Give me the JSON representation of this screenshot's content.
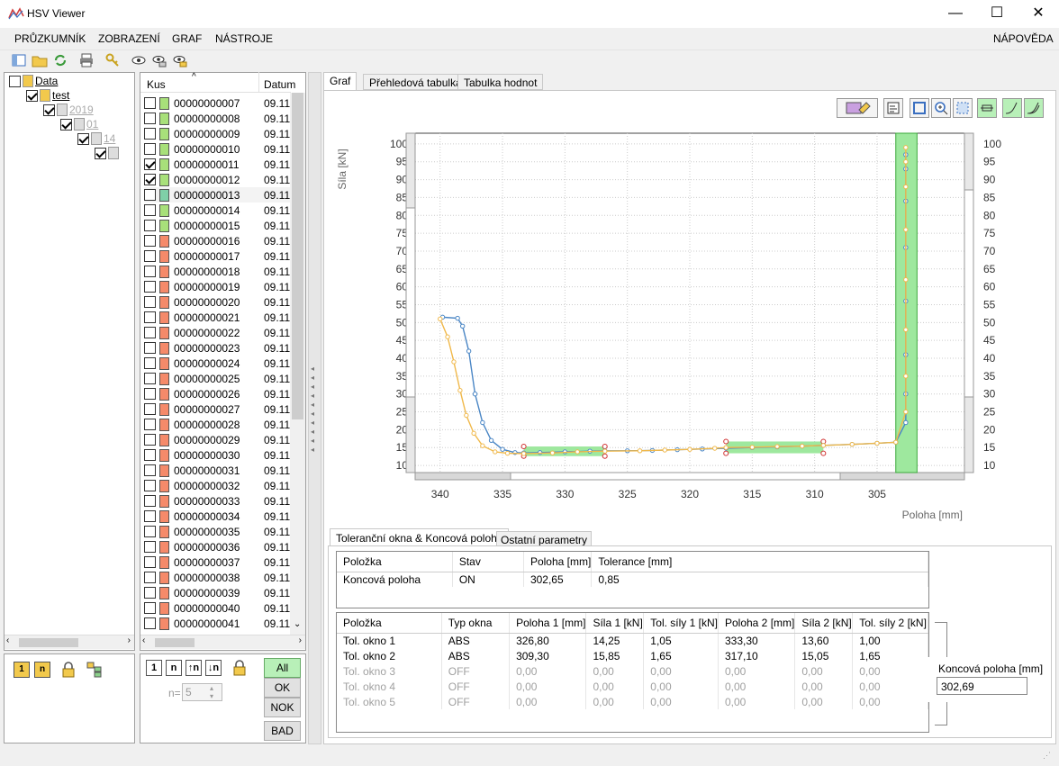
{
  "window": {
    "title": "HSV Viewer",
    "minimize": "—",
    "maximize": "☐",
    "close": "✕"
  },
  "menu": {
    "items": [
      "PRŮZKUMNÍK",
      "ZOBRAZENÍ",
      "GRAF",
      "NÁSTROJE"
    ],
    "help": "NÁPOVĚDA"
  },
  "tree": [
    {
      "label": "Data",
      "level": 0,
      "checked": false,
      "gray": false
    },
    {
      "label": "test",
      "level": 1,
      "checked": true,
      "gray": false
    },
    {
      "label": "2019",
      "level": 2,
      "checked": true,
      "gray": true
    },
    {
      "label": "01",
      "level": 3,
      "checked": true,
      "gray": true
    },
    {
      "label": "14",
      "level": 4,
      "checked": true,
      "gray": true
    },
    {
      "label": "",
      "level": 5,
      "checked": true,
      "gray": true
    }
  ],
  "list": {
    "col_kus": "Kus",
    "col_datum": "Datum",
    "items": [
      {
        "id": "00000000007",
        "date": "09.11",
        "ok": true,
        "checked": false
      },
      {
        "id": "00000000008",
        "date": "09.11",
        "ok": true,
        "checked": false
      },
      {
        "id": "00000000009",
        "date": "09.11",
        "ok": true,
        "checked": false
      },
      {
        "id": "00000000010",
        "date": "09.11",
        "ok": true,
        "checked": false
      },
      {
        "id": "00000000011",
        "date": "09.11",
        "ok": true,
        "checked": true
      },
      {
        "id": "00000000012",
        "date": "09.11",
        "ok": true,
        "checked": true
      },
      {
        "id": "00000000013",
        "date": "09.11",
        "ok": true,
        "checked": false,
        "selected": true
      },
      {
        "id": "00000000014",
        "date": "09.11",
        "ok": true,
        "checked": false
      },
      {
        "id": "00000000015",
        "date": "09.11",
        "ok": true,
        "checked": false
      },
      {
        "id": "00000000016",
        "date": "09.11",
        "ok": false,
        "checked": false
      },
      {
        "id": "00000000017",
        "date": "09.11",
        "ok": false,
        "checked": false
      },
      {
        "id": "00000000018",
        "date": "09.11",
        "ok": false,
        "checked": false
      },
      {
        "id": "00000000019",
        "date": "09.11",
        "ok": false,
        "checked": false
      },
      {
        "id": "00000000020",
        "date": "09.11",
        "ok": false,
        "checked": false
      },
      {
        "id": "00000000021",
        "date": "09.11",
        "ok": false,
        "checked": false
      },
      {
        "id": "00000000022",
        "date": "09.11",
        "ok": false,
        "checked": false
      },
      {
        "id": "00000000023",
        "date": "09.11",
        "ok": false,
        "checked": false
      },
      {
        "id": "00000000024",
        "date": "09.11",
        "ok": false,
        "checked": false
      },
      {
        "id": "00000000025",
        "date": "09.11",
        "ok": false,
        "checked": false
      },
      {
        "id": "00000000026",
        "date": "09.11",
        "ok": false,
        "checked": false
      },
      {
        "id": "00000000027",
        "date": "09.11",
        "ok": false,
        "checked": false
      },
      {
        "id": "00000000028",
        "date": "09.11",
        "ok": false,
        "checked": false
      },
      {
        "id": "00000000029",
        "date": "09.11",
        "ok": false,
        "checked": false
      },
      {
        "id": "00000000030",
        "date": "09.11",
        "ok": false,
        "checked": false
      },
      {
        "id": "00000000031",
        "date": "09.11",
        "ok": false,
        "checked": false
      },
      {
        "id": "00000000032",
        "date": "09.11",
        "ok": false,
        "checked": false
      },
      {
        "id": "00000000033",
        "date": "09.11",
        "ok": false,
        "checked": false
      },
      {
        "id": "00000000034",
        "date": "09.11",
        "ok": false,
        "checked": false
      },
      {
        "id": "00000000035",
        "date": "09.11",
        "ok": false,
        "checked": false
      },
      {
        "id": "00000000036",
        "date": "09.11",
        "ok": false,
        "checked": false
      },
      {
        "id": "00000000037",
        "date": "09.11",
        "ok": false,
        "checked": false
      },
      {
        "id": "00000000038",
        "date": "09.11",
        "ok": false,
        "checked": false
      },
      {
        "id": "00000000039",
        "date": "09.11",
        "ok": false,
        "checked": false
      },
      {
        "id": "00000000040",
        "date": "09.11",
        "ok": false,
        "checked": false
      },
      {
        "id": "00000000041",
        "date": "09.11",
        "ok": false,
        "checked": false
      }
    ]
  },
  "filter": {
    "all": "All",
    "ok": "OK",
    "nok": "NOK",
    "bad": "BAD",
    "n_label": "n=",
    "n_value": "5"
  },
  "tabs": [
    "Graf",
    "Přehledová tabulka",
    "Tabulka hodnot"
  ],
  "chart_data": {
    "type": "line",
    "ylabel": "Síla [kN]",
    "xlabel": "Poloha [mm]",
    "xlim": [
      342,
      298
    ],
    "ylim": [
      8,
      103
    ],
    "x_ticks": [
      340,
      335,
      330,
      325,
      320,
      315,
      310,
      305
    ],
    "y_ticks": [
      10,
      15,
      20,
      25,
      30,
      35,
      40,
      45,
      50,
      55,
      60,
      65,
      70,
      75,
      80,
      85,
      90,
      95,
      100
    ],
    "grid": true,
    "tolerance_boxes": [
      {
        "x1": 333.3,
        "x2": 326.8,
        "y1": 12.6,
        "y2": 15.3
      },
      {
        "x1": 317.1,
        "x2": 309.3,
        "y1": 13.4,
        "y2": 16.7
      }
    ],
    "end_band": {
      "x1": 303.5,
      "x2": 301.8
    },
    "series": [
      {
        "color": "#4a86c5",
        "x": [
          339.8,
          338.6,
          338.2,
          337.7,
          337.2,
          336.6,
          335.9,
          335.0,
          334.0,
          333.3,
          332,
          330,
          328,
          326.8,
          325,
          323,
          321,
          319,
          317.1,
          315,
          313,
          311,
          309.3,
          307,
          305,
          303.5,
          302.7,
          302.7,
          302.7,
          302.7,
          302.7,
          302.7,
          302.7,
          302.7
        ],
        "y": [
          51.5,
          51.2,
          49,
          42,
          30,
          22,
          17,
          14.5,
          13.6,
          13.5,
          13.6,
          13.8,
          14.0,
          14.1,
          14.1,
          14.2,
          14.4,
          14.6,
          14.8,
          15.0,
          15.2,
          15.4,
          15.6,
          15.9,
          16.2,
          16.5,
          22,
          30,
          41,
          56,
          71,
          84,
          93,
          97
        ]
      },
      {
        "color": "#f0b84a",
        "x": [
          340.0,
          339.4,
          338.9,
          338.4,
          337.9,
          337.3,
          336.6,
          335.6,
          334.6,
          333.3,
          331,
          329,
          326.8,
          324,
          322,
          320,
          318,
          317.1,
          315,
          313,
          311,
          309.3,
          307,
          305,
          303.5,
          302.7,
          302.7,
          302.7,
          302.7,
          302.7,
          302.7,
          302.7,
          302.7
        ],
        "y": [
          51,
          46,
          39,
          31,
          24,
          19,
          15.5,
          13.8,
          13.4,
          13.3,
          13.5,
          13.8,
          14.0,
          14.1,
          14.3,
          14.5,
          14.8,
          15.0,
          15.1,
          15.3,
          15.4,
          15.6,
          15.9,
          16.2,
          16.5,
          25,
          35,
          48,
          62,
          76,
          88,
          95,
          99
        ]
      }
    ]
  },
  "subtabs": [
    "Toleranční okna & Koncová poloha",
    "Ostatní parametry"
  ],
  "table1": {
    "headers": [
      "Položka",
      "Stav",
      "Poloha [mm]",
      "Tolerance [mm]"
    ],
    "rows": [
      [
        "Koncová poloha",
        "ON",
        "302,65",
        "0,85"
      ]
    ]
  },
  "table2": {
    "headers": [
      "Položka",
      "Typ okna",
      "Poloha 1 [mm]",
      "Síla 1 [kN]",
      "Tol. síly 1 [kN]",
      "Poloha 2 [mm]",
      "Síla 2 [kN]",
      "Tol. síly 2 [kN]"
    ],
    "rows": [
      [
        "Tol. okno 1",
        "ABS",
        "326,80",
        "14,25",
        "1,05",
        "333,30",
        "13,60",
        "1,00"
      ],
      [
        "Tol. okno 2",
        "ABS",
        "309,30",
        "15,85",
        "1,65",
        "317,10",
        "15,05",
        "1,65"
      ],
      [
        "Tol. okno 3",
        "OFF",
        "0,00",
        "0,00",
        "0,00",
        "0,00",
        "0,00",
        "0,00"
      ],
      [
        "Tol. okno 4",
        "OFF",
        "0,00",
        "0,00",
        "0,00",
        "0,00",
        "0,00",
        "0,00"
      ],
      [
        "Tol. okno 5",
        "OFF",
        "0,00",
        "0,00",
        "0,00",
        "0,00",
        "0,00",
        "0,00"
      ]
    ],
    "inactive_from": 2
  },
  "end_position": {
    "label": "Koncová poloha [mm]",
    "value": "302,69"
  }
}
